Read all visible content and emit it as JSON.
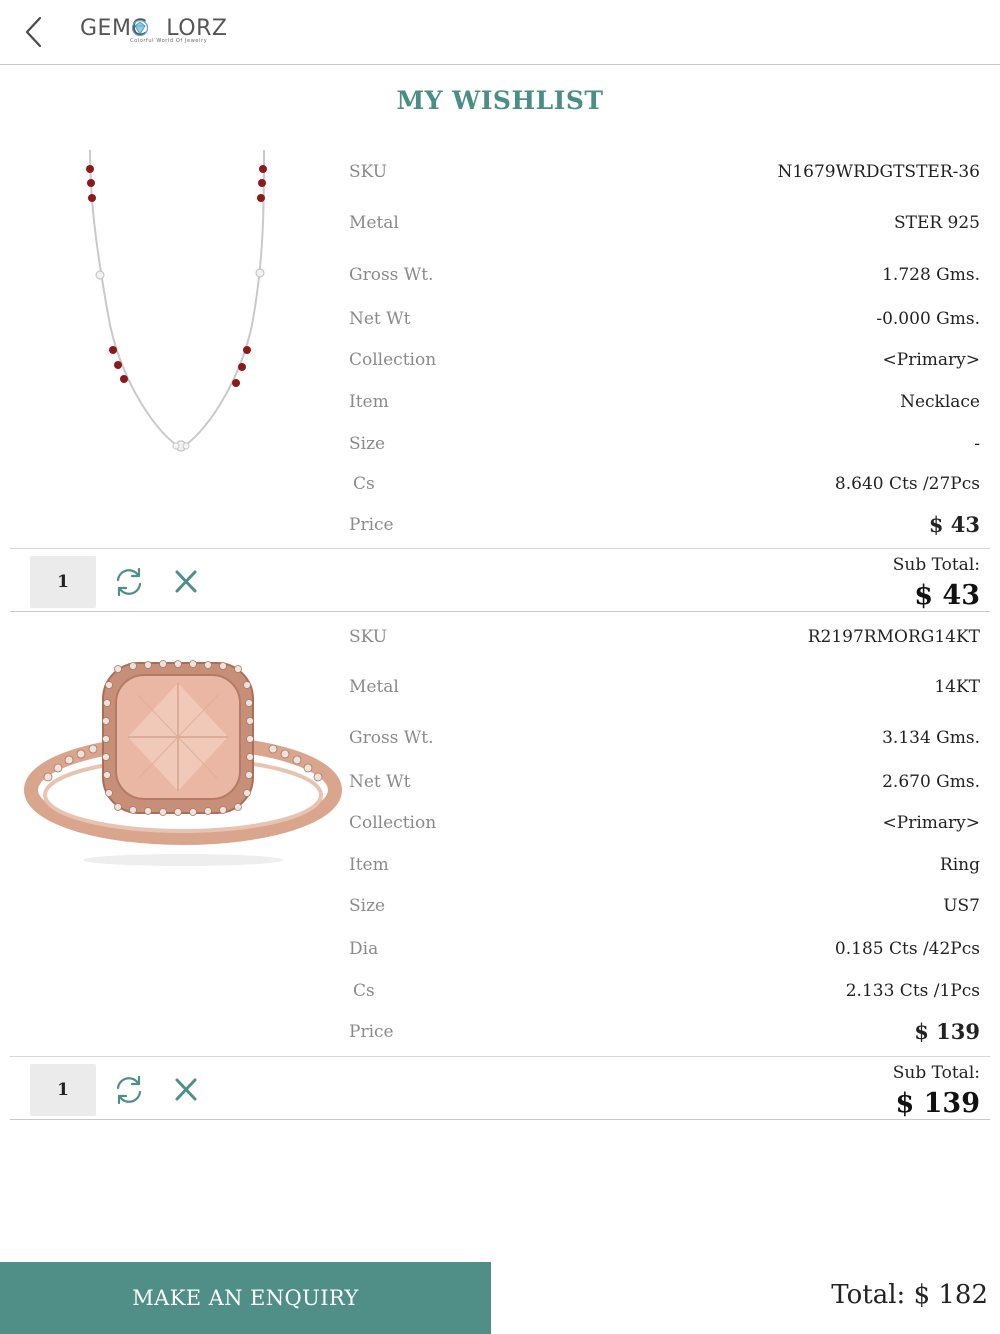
{
  "header": {
    "back_icon": "chevron-left-icon",
    "logo_text_left": "GEMC",
    "logo_text_right": "LORZ",
    "logo_tagline": "Colorful World Of Jewelry"
  },
  "page_title": "MY WISHLIST",
  "items": [
    {
      "image": "necklace",
      "specs": [
        {
          "label": "SKU",
          "value": "N1679WRDGTSTER-36"
        },
        {
          "label": "Metal",
          "value": "STER 925"
        },
        {
          "label": "Gross Wt.",
          "value": "1.728 Gms."
        },
        {
          "label": "Net Wt",
          "value": "-0.000 Gms."
        },
        {
          "label": "Collection",
          "value": "<Primary>"
        },
        {
          "label": "Item",
          "value": "Necklace"
        },
        {
          "label": "Size",
          "value": "-"
        },
        {
          "label": "Cs",
          "value": "8.640 Cts /27Pcs"
        },
        {
          "label": "Price",
          "value": "$ 43"
        }
      ],
      "quantity": "1",
      "subtotal_label": "Sub Total:",
      "subtotal_value": "$ 43"
    },
    {
      "image": "ring",
      "specs": [
        {
          "label": "SKU",
          "value": "R2197RMORG14KT"
        },
        {
          "label": "Metal",
          "value": "14KT"
        },
        {
          "label": "Gross Wt.",
          "value": "3.134 Gms."
        },
        {
          "label": "Net Wt",
          "value": "2.670 Gms."
        },
        {
          "label": "Collection",
          "value": "<Primary>"
        },
        {
          "label": "Item",
          "value": "Ring"
        },
        {
          "label": "Size",
          "value": "US7"
        },
        {
          "label": "Dia",
          "value": "0.185 Cts /42Pcs"
        },
        {
          "label": "Cs",
          "value": "2.133 Cts /1Pcs"
        },
        {
          "label": "Price",
          "value": "$ 139"
        }
      ],
      "quantity": "1",
      "subtotal_label": "Sub Total:",
      "subtotal_value": "$ 139"
    }
  ],
  "actions": {
    "refresh_icon": "refresh-icon",
    "remove_icon": "close-icon"
  },
  "footer": {
    "enquiry_label": "MAKE AN ENQUIRY",
    "total_label": "Total: $ 182"
  },
  "colors": {
    "accent": "#4f8f87",
    "title": "#4b8e86",
    "label": "#8a8a8a"
  }
}
